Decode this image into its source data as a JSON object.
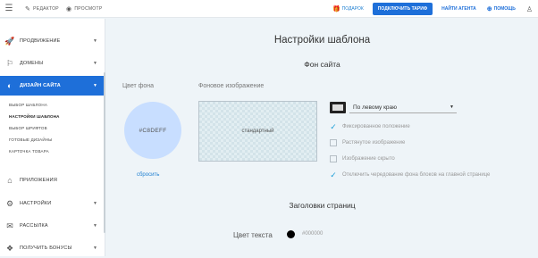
{
  "topbar": {
    "editor_label": "РЕДАКТОР",
    "preview_label": "ПРОСМОТР",
    "gift_label": "ПОДАРОК",
    "plan_button": "ПОДКЛЮЧИТЬ ТАРИФ",
    "agent_link": "НАЙТИ АГЕНТА",
    "help_label": "ПОМОЩЬ",
    "icons": {
      "menu": "hamburger-icon",
      "editor": "pencil-icon",
      "preview": "eye-icon",
      "gift": "gift-icon",
      "help": "lifebuoy-icon",
      "user": "user-icon"
    }
  },
  "sidebar": {
    "items": [
      {
        "label": "ПРОДВИЖЕНИЕ",
        "icon": "rocket-icon",
        "has_chevron": true
      },
      {
        "label": "ДОМЕНЫ",
        "icon": "flag-icon",
        "has_chevron": true
      },
      {
        "label": "ДИЗАЙН САЙТА",
        "icon": "palette-icon",
        "has_chevron": true,
        "active": true
      },
      {
        "label": "ПРИЛОЖЕНИЯ",
        "icon": "apps-icon",
        "has_chevron": false
      },
      {
        "label": "НАСТРОЙКИ",
        "icon": "sliders-icon",
        "has_chevron": true
      },
      {
        "label": "РАССЫЛКА",
        "icon": "mail-icon",
        "has_chevron": true
      },
      {
        "label": "ПОЛУЧИТЬ БОНУСЫ",
        "icon": "bonus-icon",
        "has_chevron": true
      }
    ],
    "subitems": [
      {
        "label": "ВЫБОР ШАБЛОНА",
        "current": false
      },
      {
        "label": "НАСТРОЙКИ ШАБЛОНА",
        "current": true
      },
      {
        "label": "ВЫБОР ШРИФТОВ",
        "current": false
      },
      {
        "label": "ГОТОВЫЕ ДИЗАЙНЫ",
        "current": false
      },
      {
        "label": "КАРТОЧКА ТОВАРА",
        "current": false
      }
    ]
  },
  "main": {
    "title": "Настройки шаблона",
    "background_section": {
      "title": "Фон сайта",
      "color_label": "Цвет фона",
      "color_value": "#C8DEFF",
      "reset_label": "сбросить",
      "image_label": "Фоновое изображение",
      "image_placeholder": "стандартный",
      "position_select": "По левому краю",
      "options": [
        {
          "label": "Фиксированное положение",
          "checked": true
        },
        {
          "label": "Растянутое изображение",
          "checked": false
        },
        {
          "label": "Изображение скрыто",
          "checked": false
        },
        {
          "label": "Отключить чередование фона блоков на главной странице",
          "checked": true
        }
      ]
    },
    "headings_section": {
      "title": "Заголовки страниц",
      "text_color_label": "Цвет текста",
      "text_color_value": "#000000"
    }
  },
  "colors": {
    "accent": "#1e6fd9",
    "background_swatch": "#c8deff",
    "text_swatch": "#000000",
    "page_bg": "#eef4f8"
  }
}
